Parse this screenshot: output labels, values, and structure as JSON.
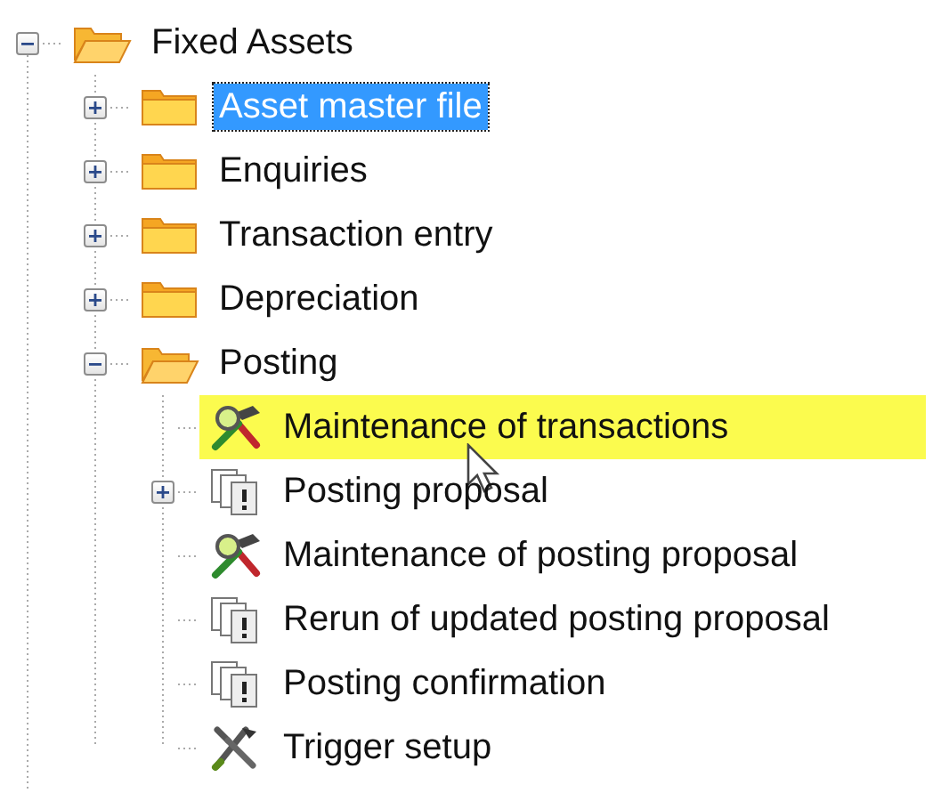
{
  "tree": {
    "label": "Fixed Assets",
    "kind": "folder",
    "expanded": true,
    "selected": false,
    "highlighted": false,
    "children": [
      {
        "label": "Asset master file",
        "kind": "folder",
        "expanded": false,
        "selected": true,
        "highlighted": false
      },
      {
        "label": "Enquiries",
        "kind": "folder",
        "expanded": false,
        "selected": false,
        "highlighted": false
      },
      {
        "label": "Transaction entry",
        "kind": "folder",
        "expanded": false,
        "selected": false,
        "highlighted": false
      },
      {
        "label": "Depreciation",
        "kind": "folder",
        "expanded": false,
        "selected": false,
        "highlighted": false
      },
      {
        "label": "Posting",
        "kind": "folder",
        "expanded": true,
        "selected": false,
        "highlighted": false,
        "children": [
          {
            "label": "Maintenance of transactions",
            "kind": "program",
            "selected": false,
            "highlighted": true,
            "pointer": true
          },
          {
            "label": "Posting proposal",
            "kind": "report",
            "expanded": false,
            "selected": false,
            "highlighted": false
          },
          {
            "label": "Maintenance of posting proposal",
            "kind": "program",
            "selected": false,
            "highlighted": false
          },
          {
            "label": "Rerun of updated posting proposal",
            "kind": "report",
            "selected": false,
            "highlighted": false
          },
          {
            "label": "Posting confirmation",
            "kind": "report",
            "selected": false,
            "highlighted": false
          },
          {
            "label": "Trigger setup",
            "kind": "tool",
            "selected": false,
            "highlighted": false
          }
        ]
      }
    ]
  }
}
